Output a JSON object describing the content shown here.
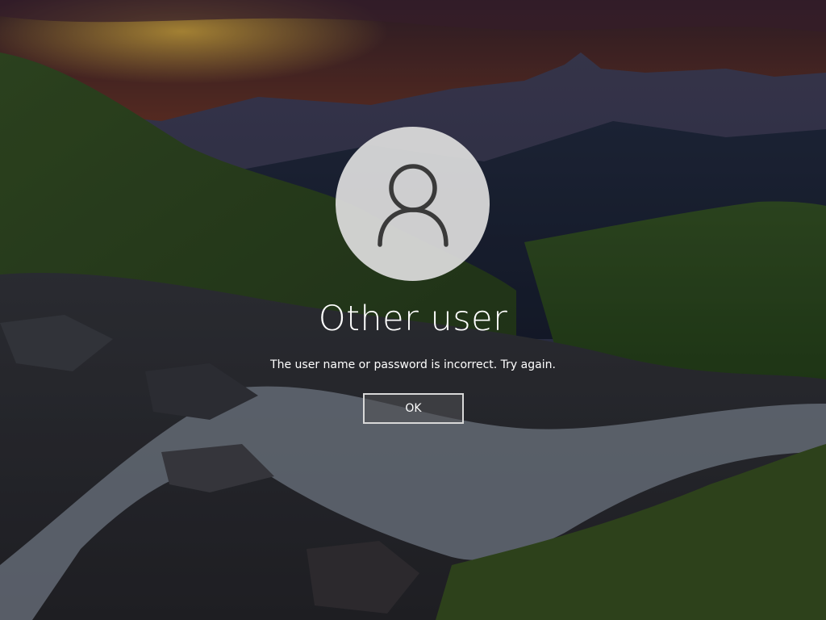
{
  "lockscreen": {
    "background": "mountain sunset valley with stream",
    "avatar_icon": "user-silhouette-icon",
    "username": "Other user",
    "error_message": "The user name or password is incorrect. Try again.",
    "ok_label": "OK"
  },
  "colors": {
    "text": "#ffffff",
    "avatar_bg": "#dadada",
    "avatar_icon": "#3a3a3a",
    "button_border": "#d8d8d8"
  }
}
